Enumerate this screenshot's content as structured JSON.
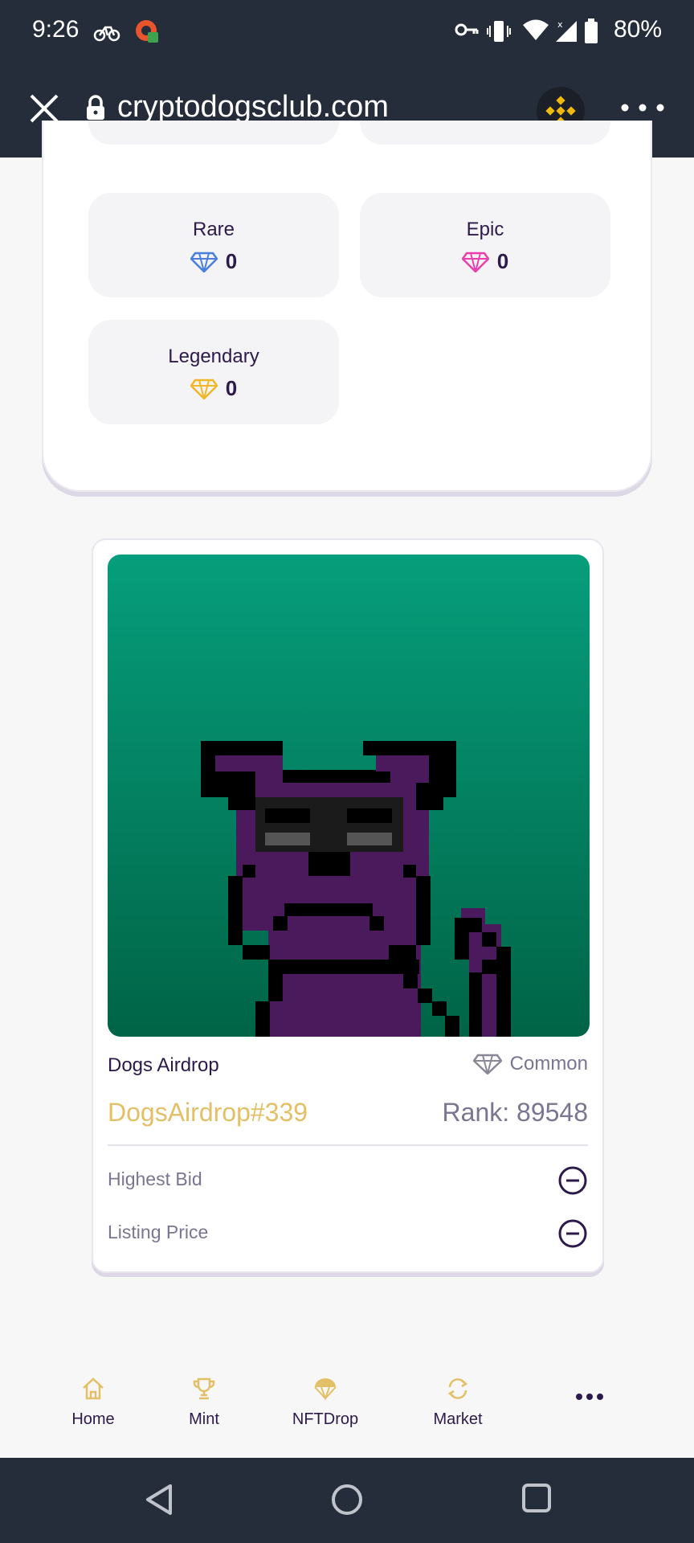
{
  "status_bar": {
    "time": "9:26",
    "battery": "80%"
  },
  "browser": {
    "url": "cryptodogsclub.com"
  },
  "rarity_grid": {
    "tiles": [
      {
        "label": "Rare",
        "count": "0",
        "gem_color": "#4a7fe0"
      },
      {
        "label": "Epic",
        "count": "0",
        "gem_color": "#ea3fae"
      },
      {
        "label": "Legendary",
        "count": "0",
        "gem_color": "#f2b727"
      }
    ]
  },
  "nft": {
    "collection": "Dogs Airdrop",
    "rarity": "Common",
    "token_name": "DogsAirdrop#339",
    "rank": "Rank: 89548",
    "highest_bid_label": "Highest Bid",
    "listing_price_label": "Listing Price"
  },
  "bottom_nav": {
    "items": [
      {
        "label": "Home",
        "icon": "home-icon"
      },
      {
        "label": "Mint",
        "icon": "trophy-icon"
      },
      {
        "label": "NFTDrop",
        "icon": "parachute-icon"
      },
      {
        "label": "Market",
        "icon": "swap-icon"
      }
    ],
    "more_icon": "more-dots-icon"
  },
  "colors": {
    "accent": "#e3c067",
    "text_dark": "#2c1a4a",
    "text_muted": "#7a7590",
    "bar_bg": "#252d3b"
  }
}
